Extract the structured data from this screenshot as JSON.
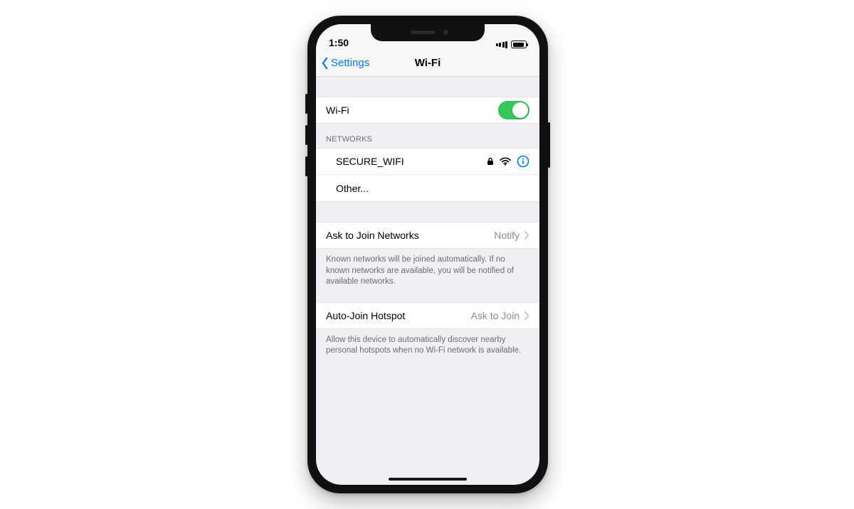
{
  "statusbar": {
    "time": "1:50"
  },
  "nav": {
    "back": "Settings",
    "title": "Wi-Fi"
  },
  "wifi_row": {
    "label": "Wi-Fi",
    "on": true
  },
  "networks": {
    "header": "NETWORKS",
    "items": [
      {
        "name": "SECURE_WIFI",
        "secured": true
      }
    ],
    "other": "Other..."
  },
  "ask_join": {
    "label": "Ask to Join Networks",
    "value": "Notify",
    "footer": "Known networks will be joined automatically. If no known networks are available, you will be notified of available networks."
  },
  "auto_hotspot": {
    "label": "Auto-Join Hotspot",
    "value": "Ask to Join",
    "footer": "Allow this device to automatically discover nearby personal hotspots when no Wi-Fi network is available."
  },
  "colors": {
    "tint": "#007aff",
    "toggle_on": "#34c759",
    "bg": "#efeff4"
  }
}
